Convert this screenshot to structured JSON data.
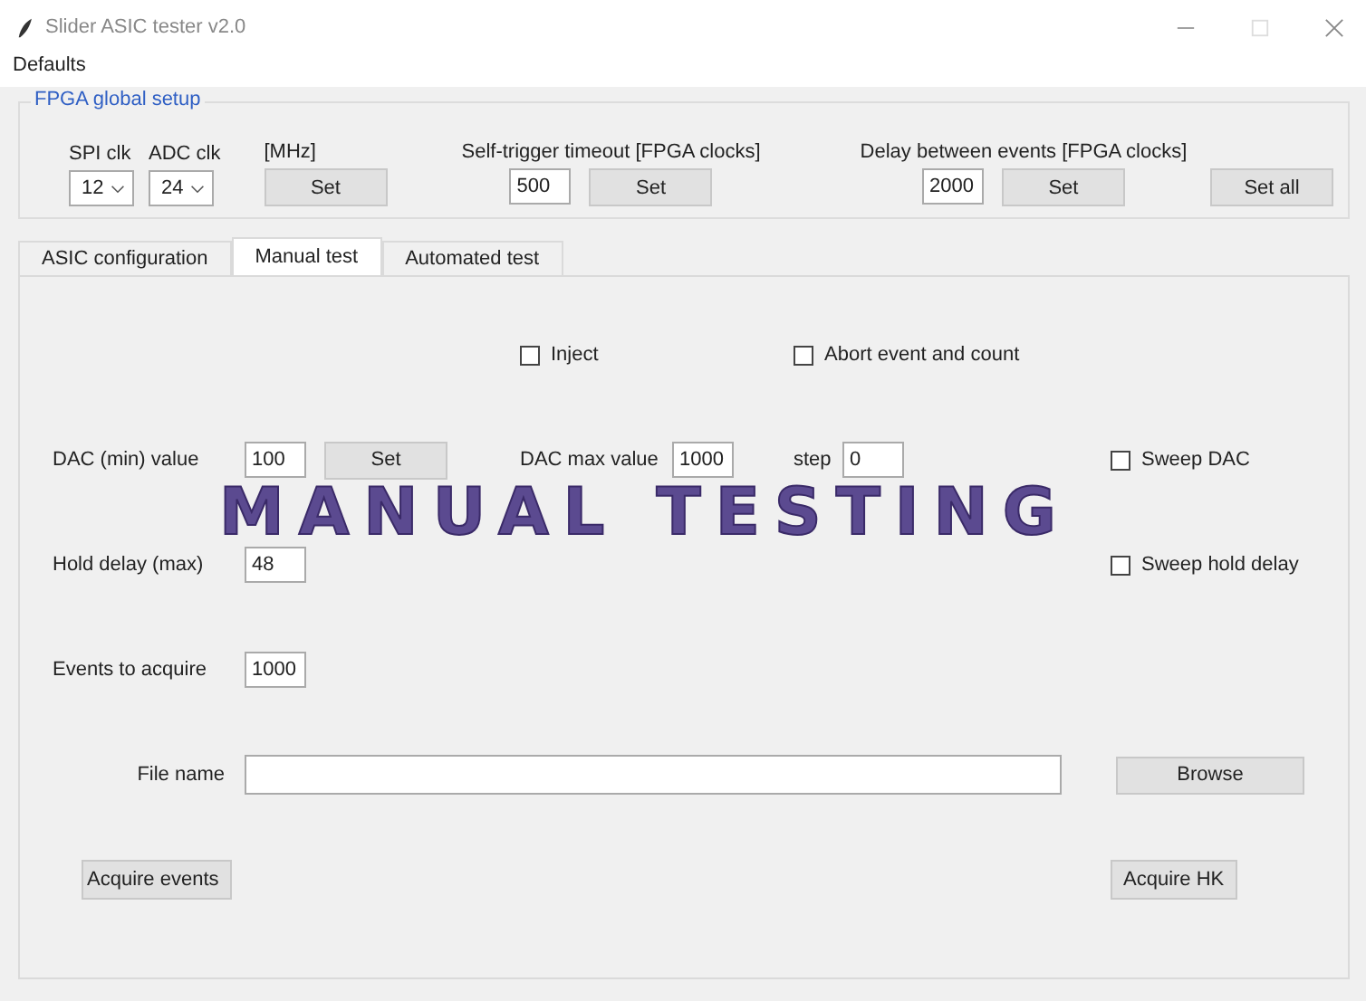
{
  "window": {
    "title": "Slider ASIC tester v2.0"
  },
  "menu": [
    "Defaults"
  ],
  "fpga_setup": {
    "title": "FPGA global setup",
    "spi_clk": {
      "label": "SPI clk",
      "value": "12"
    },
    "adc_clk": {
      "label": "ADC clk",
      "value": "24"
    },
    "mhz_label": "[MHz]",
    "clk_button": "Set",
    "self_trigger": {
      "label": "Self-trigger timeout [FPGA clocks]",
      "value": "500",
      "button": "Set"
    },
    "delay": {
      "label": "Delay between events [FPGA clocks]",
      "value": "2000",
      "button": "Set"
    },
    "set_all_button": "Set all"
  },
  "tabs": [
    {
      "label": "ASIC configuration",
      "selected": false
    },
    {
      "label": "Manual test",
      "selected": true
    },
    {
      "label": "Automated test",
      "selected": false
    }
  ],
  "manual_test": {
    "overlay": "MANUAL TESTING",
    "inject": {
      "label": "Inject",
      "checked": false
    },
    "abort": {
      "label": "Abort event and count",
      "checked": false
    },
    "dac_min": {
      "label": "DAC (min) value",
      "value": "100",
      "button": "Set"
    },
    "dac_max": {
      "label": "DAC max value",
      "value": "1000"
    },
    "step": {
      "label": "step",
      "value": "0"
    },
    "sweep_dac": {
      "label": "Sweep DAC",
      "checked": false
    },
    "hold_delay": {
      "label": "Hold delay (max)",
      "value": "48"
    },
    "sweep_hold": {
      "label": "Sweep hold delay",
      "checked": false
    },
    "events": {
      "label": "Events to acquire",
      "value": "1000"
    },
    "file_name": {
      "label": "File name"
    },
    "browse_button": "Browse",
    "acquire_events_button": "Acquire events",
    "acquire_hk_button": "Acquire HK"
  }
}
